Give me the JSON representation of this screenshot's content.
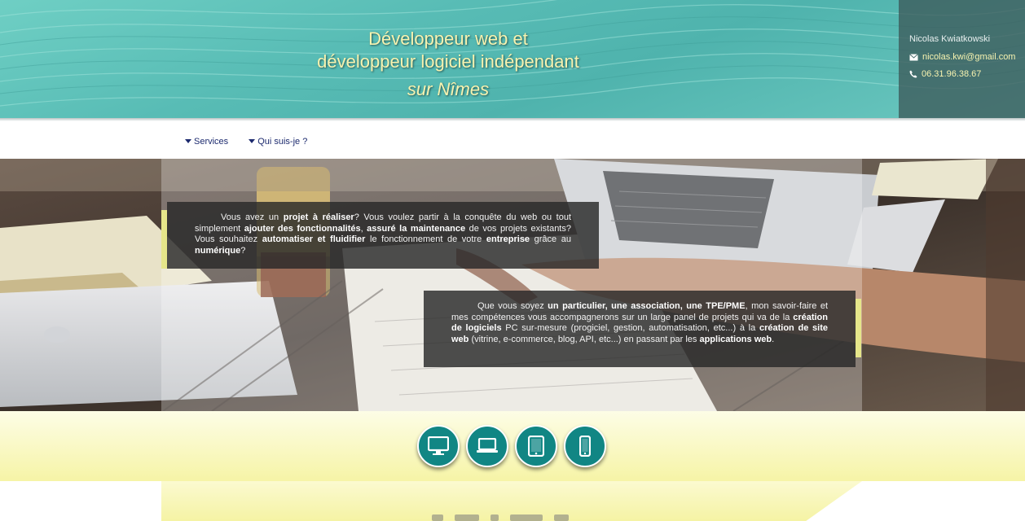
{
  "header": {
    "title_line1": "Développeur web et",
    "title_line2": "développeur logiciel indépendant",
    "title_sub": "sur Nîmes"
  },
  "contact": {
    "name": "Nicolas Kwiatkowski",
    "email": "nicolas.kwi@gmail.com",
    "phone": "06.31.96.38.67",
    "email_icon": "envelope-icon",
    "phone_icon": "phone-icon"
  },
  "nav": {
    "items": [
      {
        "label": "Services",
        "icon": "caret-down-icon"
      },
      {
        "label": "Qui suis-je ?",
        "icon": "caret-down-icon"
      }
    ]
  },
  "hero": {
    "box1": {
      "t1": "Vous avez un ",
      "b1": "projet à réaliser",
      "t2": "? Vous voulez partir à la conquête du web ou tout simplement ",
      "b2": "ajouter des fonctionnalités",
      "t3": ", ",
      "b3": "assuré la maintenance",
      "t4": " de vos projets existants? Vous souhaitez ",
      "b4": "automatiser et fluidifier",
      "t5": " le fonctionnement de votre ",
      "b5": "entreprise",
      "t6": " grâce au ",
      "b6": "numérique",
      "t7": "?"
    },
    "box2": {
      "t1": "Que vous soyez ",
      "b1": "un particulier, une association, une TPE/PME",
      "t2": ", mon savoir-faire et mes compétences vous accompagnerons sur un large panel de projets qui va de la ",
      "b2": "création de logiciels",
      "t3": " PC sur-mesure (progiciel, gestion, automatisation, etc...) à la ",
      "b3": "création de site web",
      "t4": " (vitrine, e-commerce, blog, API, etc...) en passant par les ",
      "b4": "applications web",
      "t5": "."
    }
  },
  "devices": [
    {
      "icon": "desktop-icon"
    },
    {
      "icon": "laptop-icon"
    },
    {
      "icon": "tablet-icon"
    },
    {
      "icon": "smartphone-icon"
    }
  ],
  "colors": {
    "header_teal": "#58bcb5",
    "title_yellow": "#f7f3b0",
    "device_circle": "#118684",
    "nav_text": "#1c2a6e",
    "band_yellow": "#f6f4a6"
  }
}
